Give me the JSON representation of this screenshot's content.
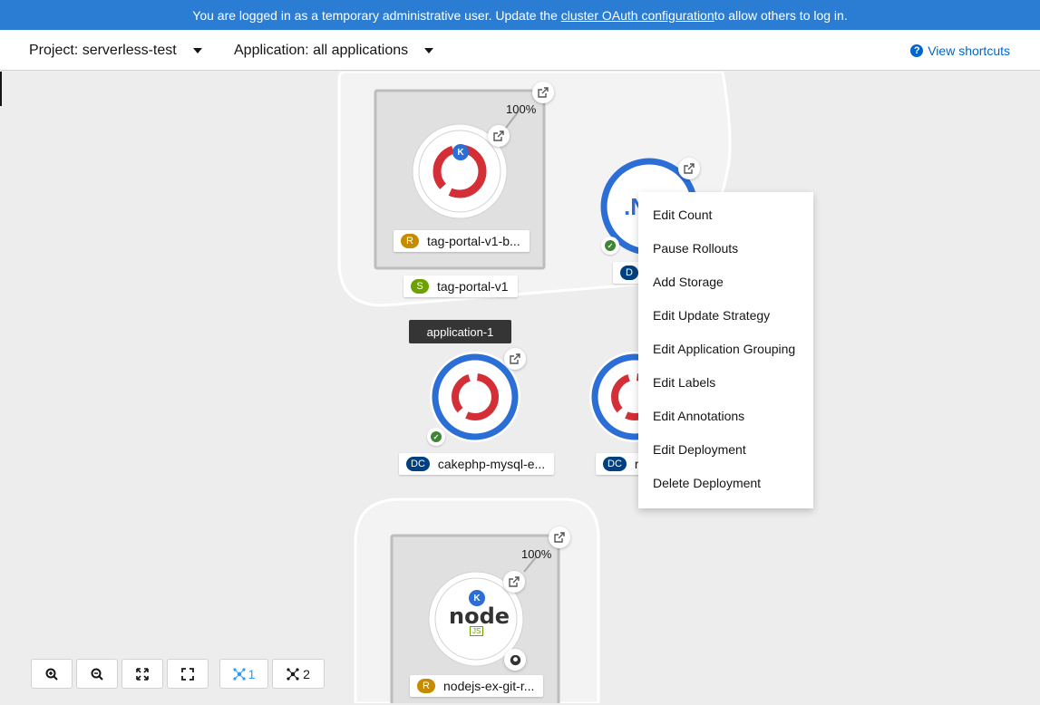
{
  "banner": {
    "prefix": "You are logged in as a temporary administrative user. Update the ",
    "link": "cluster OAuth configuration",
    "suffix": " to allow others to log in."
  },
  "toolbar": {
    "project": "Project: serverless-test",
    "application": "Application: all applications",
    "shortcuts": "View shortcuts"
  },
  "topology": {
    "revision_label": "tag-portal-v1-b...",
    "revision_badge": "R",
    "service_label": "tag-portal-v1",
    "service_badge": "S",
    "traffic_1": "100%",
    "deployment_badge": "D",
    "group_tooltip": "application-1",
    "dc1_badge": "DC",
    "dc1_label": "cakephp-mysql-e...",
    "dc2_badge": "DC",
    "dc2_label": "r",
    "traffic_2": "100%",
    "revision2_badge": "R",
    "revision2_label": "nodejs-ex-git-r...",
    "knative_badge": "K",
    "node_logo": "node",
    "node_sub": "JS"
  },
  "context_menu": {
    "items": [
      "Edit Count",
      "Pause Rollouts",
      "Add Storage",
      "Edit Update Strategy",
      "Edit Application Grouping",
      "Edit Labels",
      "Edit Annotations",
      "Edit Deployment",
      "Delete Deployment"
    ]
  },
  "controls": {
    "filter1": "1",
    "filter2": "2"
  },
  "colors": {
    "banner": "#2b7cd3",
    "link": "#0066cc",
    "openshift_red": "#d42e36",
    "deploy_blue": "#2b6fd6"
  }
}
